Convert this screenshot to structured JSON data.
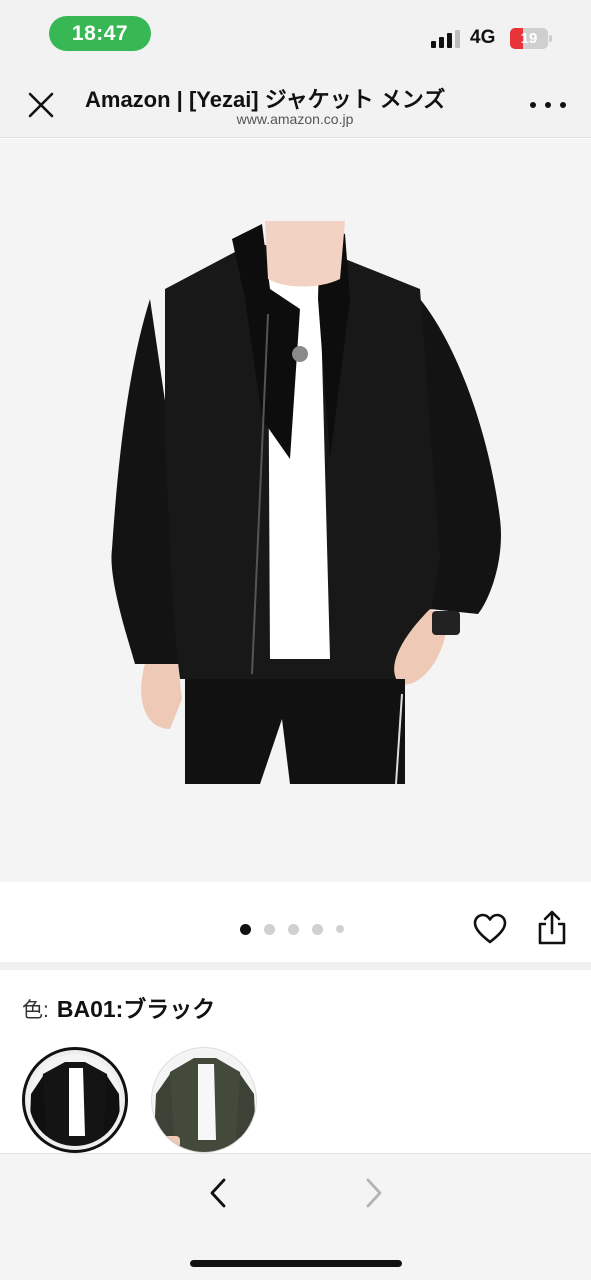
{
  "status_bar": {
    "time": "18:47",
    "network": "4G",
    "battery": "19",
    "battery_level": 0.19,
    "time_pill_color": "#38b855",
    "battery_color": "#e8333a"
  },
  "browser": {
    "title": "Amazon | [Yezai] ジャケット メンズ",
    "url": "www.amazon.co.jp",
    "close_icon": "close-icon",
    "more_icon": "more-icon"
  },
  "product": {
    "image_icon": "product-photo",
    "carousel": {
      "total": 5,
      "active_index": 0
    },
    "actions": [
      "heart-icon",
      "share-icon"
    ]
  },
  "color_selector": {
    "label": "色:",
    "value": "BA01:ブラック",
    "swatches": [
      {
        "name": "black",
        "hex": "#141414",
        "selected": true
      },
      {
        "name": "olive",
        "hex": "#434a3b",
        "selected": false
      }
    ]
  },
  "bottom_nav": {
    "back_icon": "chevron-left-icon",
    "forward_icon": "chevron-right-icon"
  }
}
